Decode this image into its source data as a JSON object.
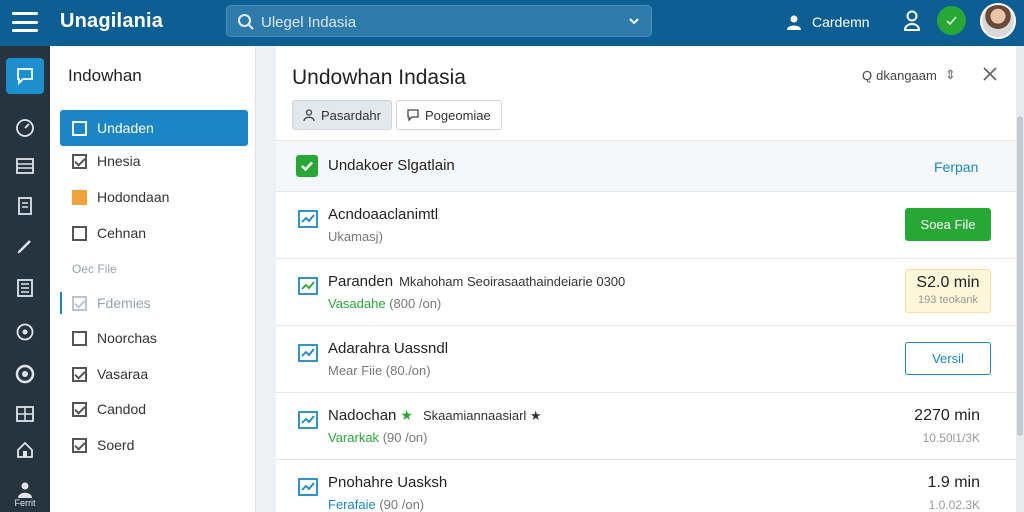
{
  "app": {
    "title": "Unagilania"
  },
  "search": {
    "placeholder": "Ulegel Indasia"
  },
  "topbar": {
    "user_label": "Cardemn"
  },
  "rail": {
    "bottom_label": "Ferrit"
  },
  "sidebar": {
    "title": "Indowhan",
    "items": [
      {
        "label": "Undaden",
        "state": "active"
      },
      {
        "label": "Hnesia",
        "state": "checked"
      },
      {
        "label": "Hodondaan",
        "state": "orange"
      },
      {
        "label": "Cehnan",
        "state": "empty"
      }
    ],
    "section": "Oec File",
    "items2": [
      {
        "label": "Fdemies",
        "state": "muted"
      },
      {
        "label": "Noorchas",
        "state": "empty"
      },
      {
        "label": "Vasaraa",
        "state": "checked"
      },
      {
        "label": "Candod",
        "state": "checked"
      },
      {
        "label": "Soerd",
        "state": "checked"
      }
    ]
  },
  "main": {
    "title": "Undowhan Indasia",
    "search_label": "dkangaam",
    "tabs": [
      {
        "label": "Pasardahr"
      },
      {
        "label": "Pogeomiae"
      }
    ],
    "list_header": {
      "title": "Undakoer Slgatlain",
      "link": "Ferpan"
    },
    "rows": [
      {
        "title": "Acndoaaclanimtl",
        "extra": "",
        "sub_prefix": "",
        "sub": "Ukamasj)",
        "action": "Soea File"
      },
      {
        "title": "Paranden",
        "extra": "Mkahoham Seoirasaathaindeiarie 0300",
        "sub_prefix": "Vasadahe",
        "sub": "(800 /on)",
        "price": "S2.0 min",
        "price_sub": "193 teokank"
      },
      {
        "title": "Adarahra Uassndl",
        "extra": "",
        "sub_prefix": "",
        "sub": "Mear Fiie (80./on)",
        "action": "Versil"
      },
      {
        "title": "Nadochan",
        "extra": "Skaamiannaasiarl ★",
        "sub_prefix": "Vararkak",
        "sub": "(90 /on)",
        "price": "2270 min",
        "price_sub": "10.50l1/3K"
      },
      {
        "title": "Pnohahre Uasksh",
        "extra": "",
        "sub_prefix": "Ferafaie",
        "sub": "(90 /on)",
        "price": "1.9 min",
        "price_sub": "1.0.02.3K"
      }
    ]
  },
  "colors": {
    "brand": "#0d5f93",
    "accent": "#1b86c7",
    "success": "#27a836",
    "rail": "#26343f"
  }
}
